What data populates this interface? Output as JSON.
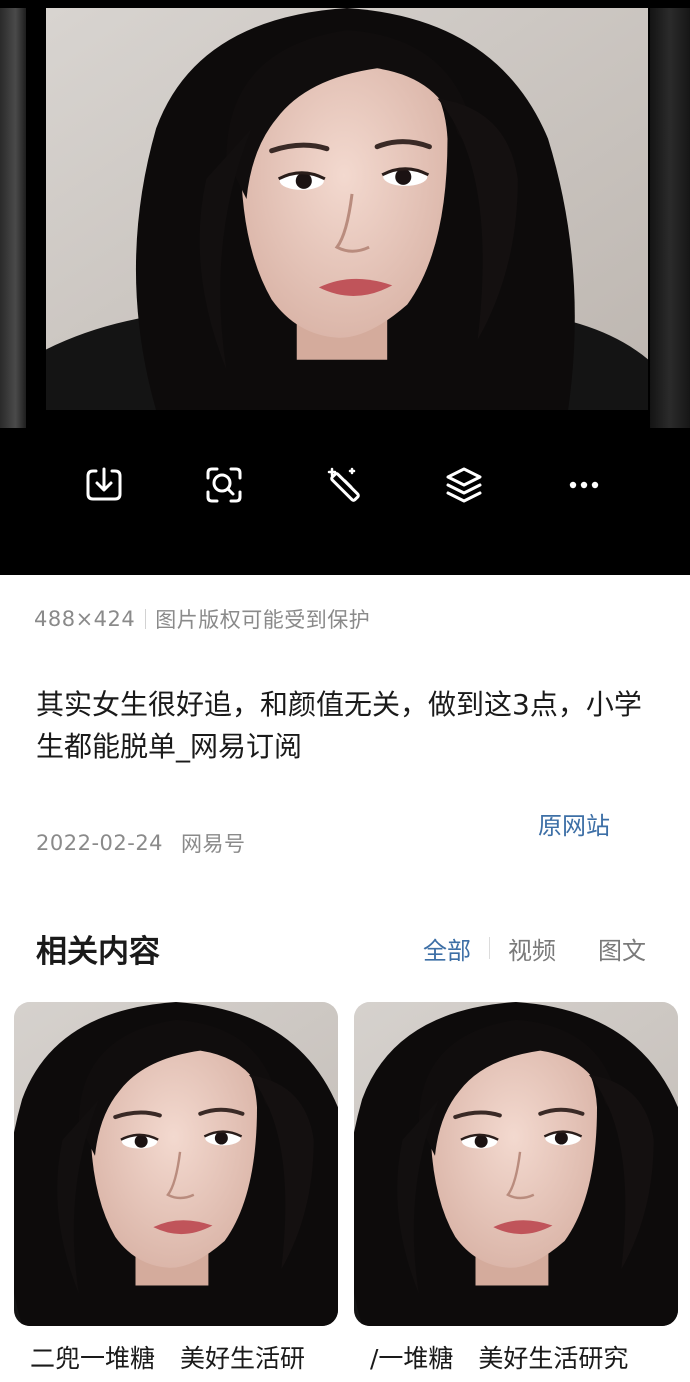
{
  "viewer": {
    "toolbar": [
      {
        "id": "download",
        "icon": "download-icon"
      },
      {
        "id": "search-image",
        "icon": "image-search-icon"
      },
      {
        "id": "magic-edit",
        "icon": "magic-wand-icon"
      },
      {
        "id": "layers",
        "icon": "layers-icon"
      },
      {
        "id": "more",
        "icon": "more-icon"
      }
    ]
  },
  "info": {
    "dimensions": "488×424",
    "copyright_note": "图片版权可能受到保护",
    "title": "其实女生很好追，和颜值无关，做到这3点，小学生都能脱单_网易订阅",
    "date": "2022-02-24",
    "source": "网易号",
    "origin_link": "原网站"
  },
  "related": {
    "heading": "相关内容",
    "tabs": [
      {
        "label": "全部",
        "active": true
      },
      {
        "label": "视频",
        "active": false
      },
      {
        "label": "图文",
        "active": false
      }
    ],
    "cards": [
      {
        "title": "二兜一堆糖　美好生活研"
      },
      {
        "title": "/一堆糖　美好生活研究"
      }
    ]
  },
  "colors": {
    "link": "#3d6fa6",
    "meta_text": "#8a8a8a",
    "body_text": "#1a1a1a",
    "viewer_bg": "#000000"
  }
}
